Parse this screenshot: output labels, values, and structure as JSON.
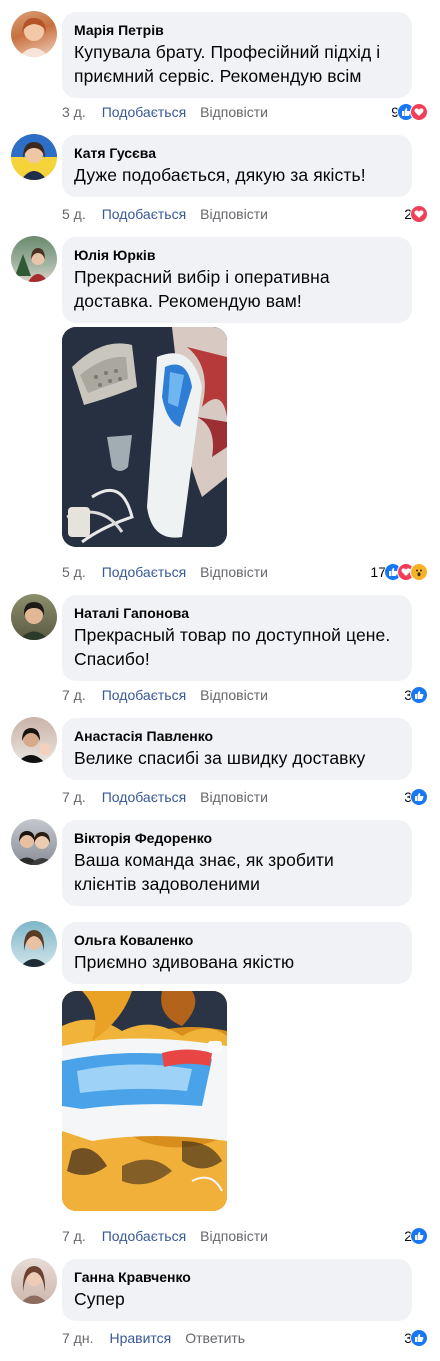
{
  "comments": [
    {
      "name": "Марія Петрів",
      "text": "Купувала брату. Професійний підхід і приємний сервіс. Рекомендую всім",
      "time": "3 д.",
      "like": "Подобається",
      "reply": "Відповісти",
      "reaction_count": "9",
      "reactions": [
        "like-icon",
        "love-icon"
      ]
    },
    {
      "name": "Катя Гусєва",
      "text": "Дуже подобається, дякую за якість!",
      "time": "5 д.",
      "like": "Подобається",
      "reply": "Відповісти",
      "reaction_count": "2",
      "reactions": [
        "love-icon"
      ]
    },
    {
      "name": "Юлія Юрків",
      "text": "Прекрасний вибір і оперативна доставка. Рекомендую вам!",
      "time": "5 д.",
      "like": "Подобається",
      "reply": "Відповісти",
      "reaction_count": "17",
      "reactions": [
        "like-icon",
        "love-icon",
        "wow-icon"
      ]
    },
    {
      "name": "Наталі Гапонова",
      "text": "Прекрасный товар по доступной цене. Спасибо!",
      "time": "7 д.",
      "like": "Подобається",
      "reply": "Відповісти",
      "reaction_count": "3",
      "reactions": [
        "like-icon"
      ]
    },
    {
      "name": "Анастасія Павленко",
      "text": "Велике спасибі за швидку доставку",
      "time": "7 д.",
      "like": "Подобається",
      "reply": "Відповісти",
      "reaction_count": "3",
      "reactions": [
        "like-icon"
      ]
    },
    {
      "name": "Вікторія Федоренко",
      "text": "Ваша команда знає, як зробити клієнтів задоволеними"
    },
    {
      "name": "Ольга Коваленко",
      "text": "Приємно здивована якістю",
      "time": "7 д.",
      "like": "Подобається",
      "reply": "Відповісти",
      "reaction_count": "2",
      "reactions": [
        "like-icon"
      ]
    },
    {
      "name": "Ганна Кравченко",
      "text": "Супер",
      "time": "7 дн.",
      "like": "Нравится",
      "reply": "Ответить",
      "reaction_count": "3",
      "reactions": [
        "like-icon"
      ]
    }
  ],
  "colors": {
    "bubble": "#f0f2f5",
    "link": "#385898",
    "muted": "#65676b",
    "like_blue": "#1877f2",
    "love_red": "#f33e58"
  }
}
